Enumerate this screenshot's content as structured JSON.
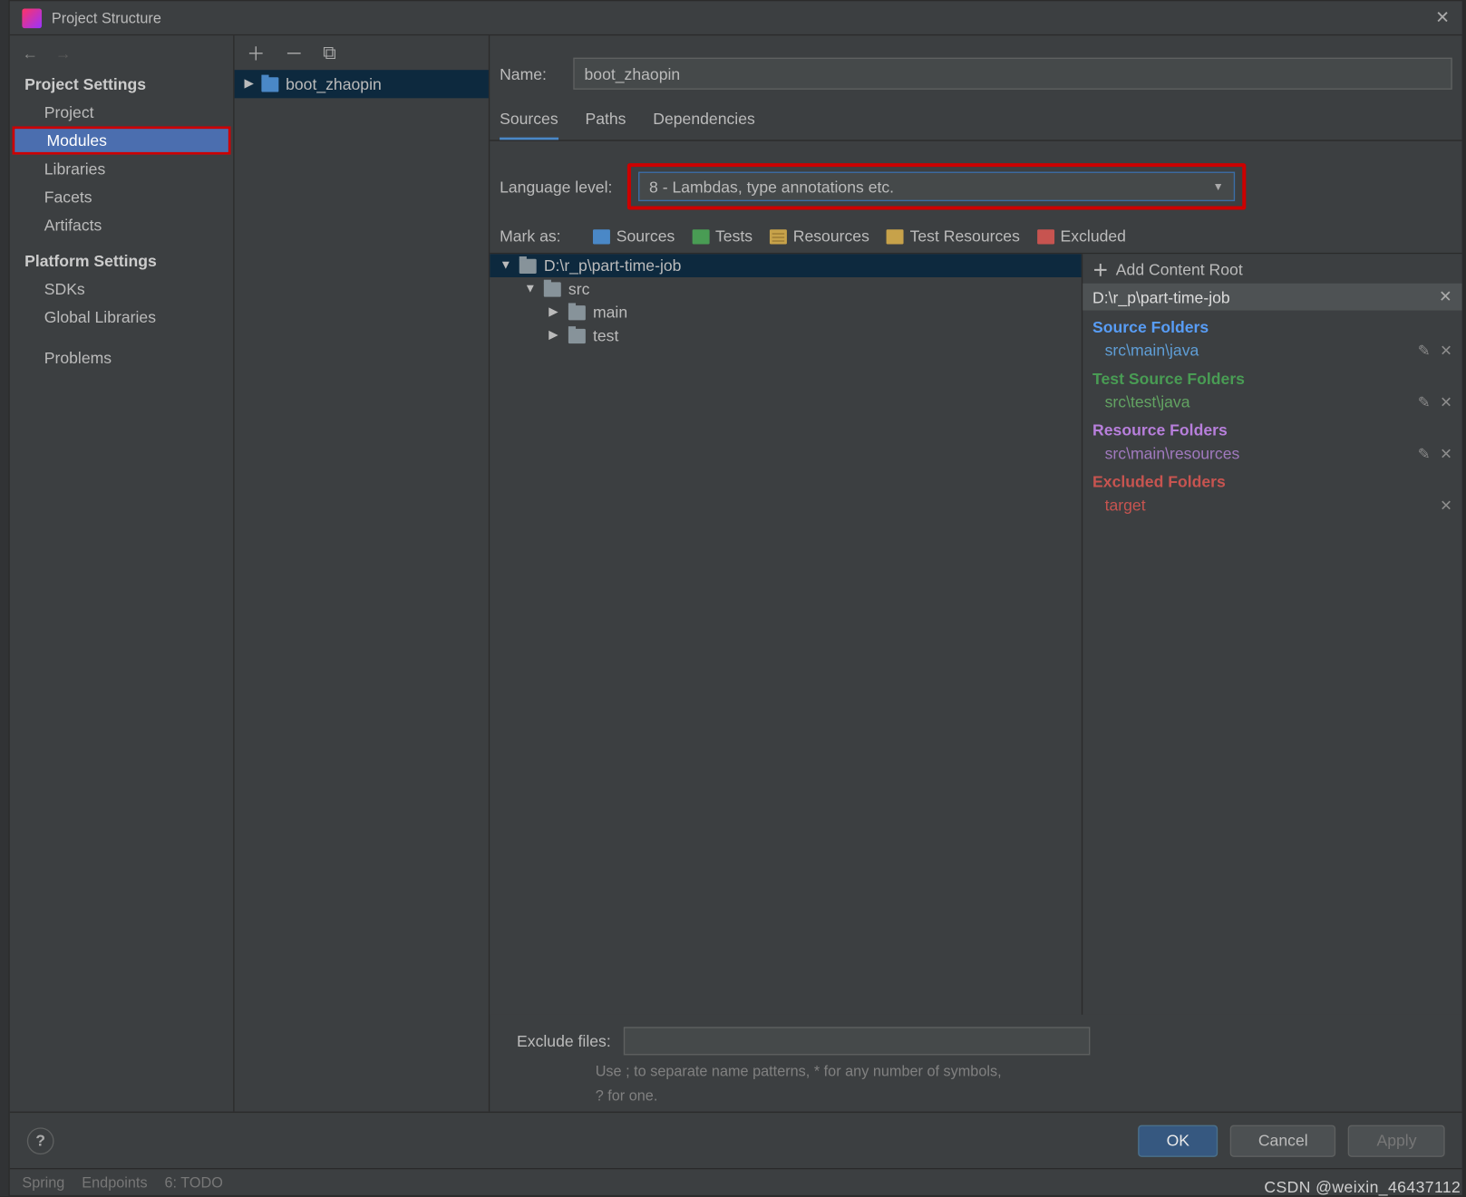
{
  "window": {
    "title": "Project Structure"
  },
  "sidebar": {
    "project_settings_head": "Project Settings",
    "platform_settings_head": "Platform Settings",
    "items": {
      "project": "Project",
      "modules": "Modules",
      "libraries": "Libraries",
      "facets": "Facets",
      "artifacts": "Artifacts",
      "sdks": "SDKs",
      "global_libraries": "Global Libraries",
      "problems": "Problems"
    }
  },
  "modules_list": {
    "item0": "boot_zhaopin"
  },
  "main": {
    "name_label": "Name:",
    "name_value": "boot_zhaopin",
    "tabs": {
      "sources": "Sources",
      "paths": "Paths",
      "dependencies": "Dependencies"
    },
    "language_level_label": "Language level:",
    "language_level_value": "8 - Lambdas, type annotations etc.",
    "mark_as_label": "Mark as:",
    "marks": {
      "sources": "Sources",
      "tests": "Tests",
      "resources": "Resources",
      "test_resources": "Test Resources",
      "excluded": "Excluded"
    },
    "tree": {
      "root": "D:\\r_p\\part-time-job",
      "src": "src",
      "main": "main",
      "test": "test"
    },
    "right": {
      "add_content_root": "Add Content Root",
      "content_root_path": "D:\\r_p\\part-time-job",
      "source_folders_head": "Source Folders",
      "source_folders_item": "src\\main\\java",
      "test_source_folders_head": "Test Source Folders",
      "test_source_folders_item": "src\\test\\java",
      "resource_folders_head": "Resource Folders",
      "resource_folders_item": "src\\main\\resources",
      "excluded_folders_head": "Excluded Folders",
      "excluded_folders_item": "target"
    },
    "exclude_files_label": "Exclude files:",
    "exclude_hint1": "Use ; to separate name patterns, * for any number of symbols,",
    "exclude_hint2": "? for one."
  },
  "footer": {
    "ok": "OK",
    "cancel": "Cancel",
    "apply": "Apply"
  },
  "statusbar": {
    "spring": "Spring",
    "endpoints": "Endpoints",
    "todo": "6: TODO"
  },
  "watermark": "CSDN @weixin_46437112"
}
